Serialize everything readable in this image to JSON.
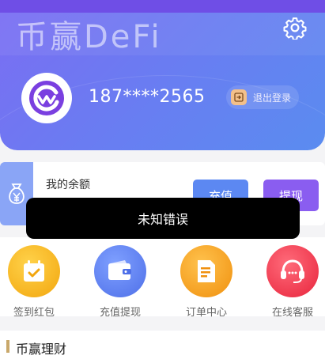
{
  "header": {
    "brand": "币赢DeFi",
    "phone": "187****2565",
    "logout_label": "退出登录"
  },
  "balance": {
    "label": "我的余额",
    "recharge_label": "充值",
    "withdraw_label": "提现"
  },
  "toast": {
    "message": "未知错误"
  },
  "menu": {
    "items": [
      {
        "label": "签到红包",
        "icon": "calendar-check-icon",
        "color": "#f5b81c"
      },
      {
        "label": "充值提现",
        "icon": "wallet-icon",
        "color": "#5b7ff0"
      },
      {
        "label": "订单中心",
        "icon": "document-icon",
        "color": "#f6a21c"
      },
      {
        "label": "在线客服",
        "icon": "headset-icon",
        "color": "#f0485a"
      }
    ]
  },
  "section": {
    "title": "币赢理财"
  },
  "colors": {
    "header_start": "#7b6df3",
    "header_end": "#5a8cf0",
    "recharge_button": "#5c88f2",
    "withdraw_button": "#8a5df0",
    "section_accent": "#c9a86a"
  }
}
